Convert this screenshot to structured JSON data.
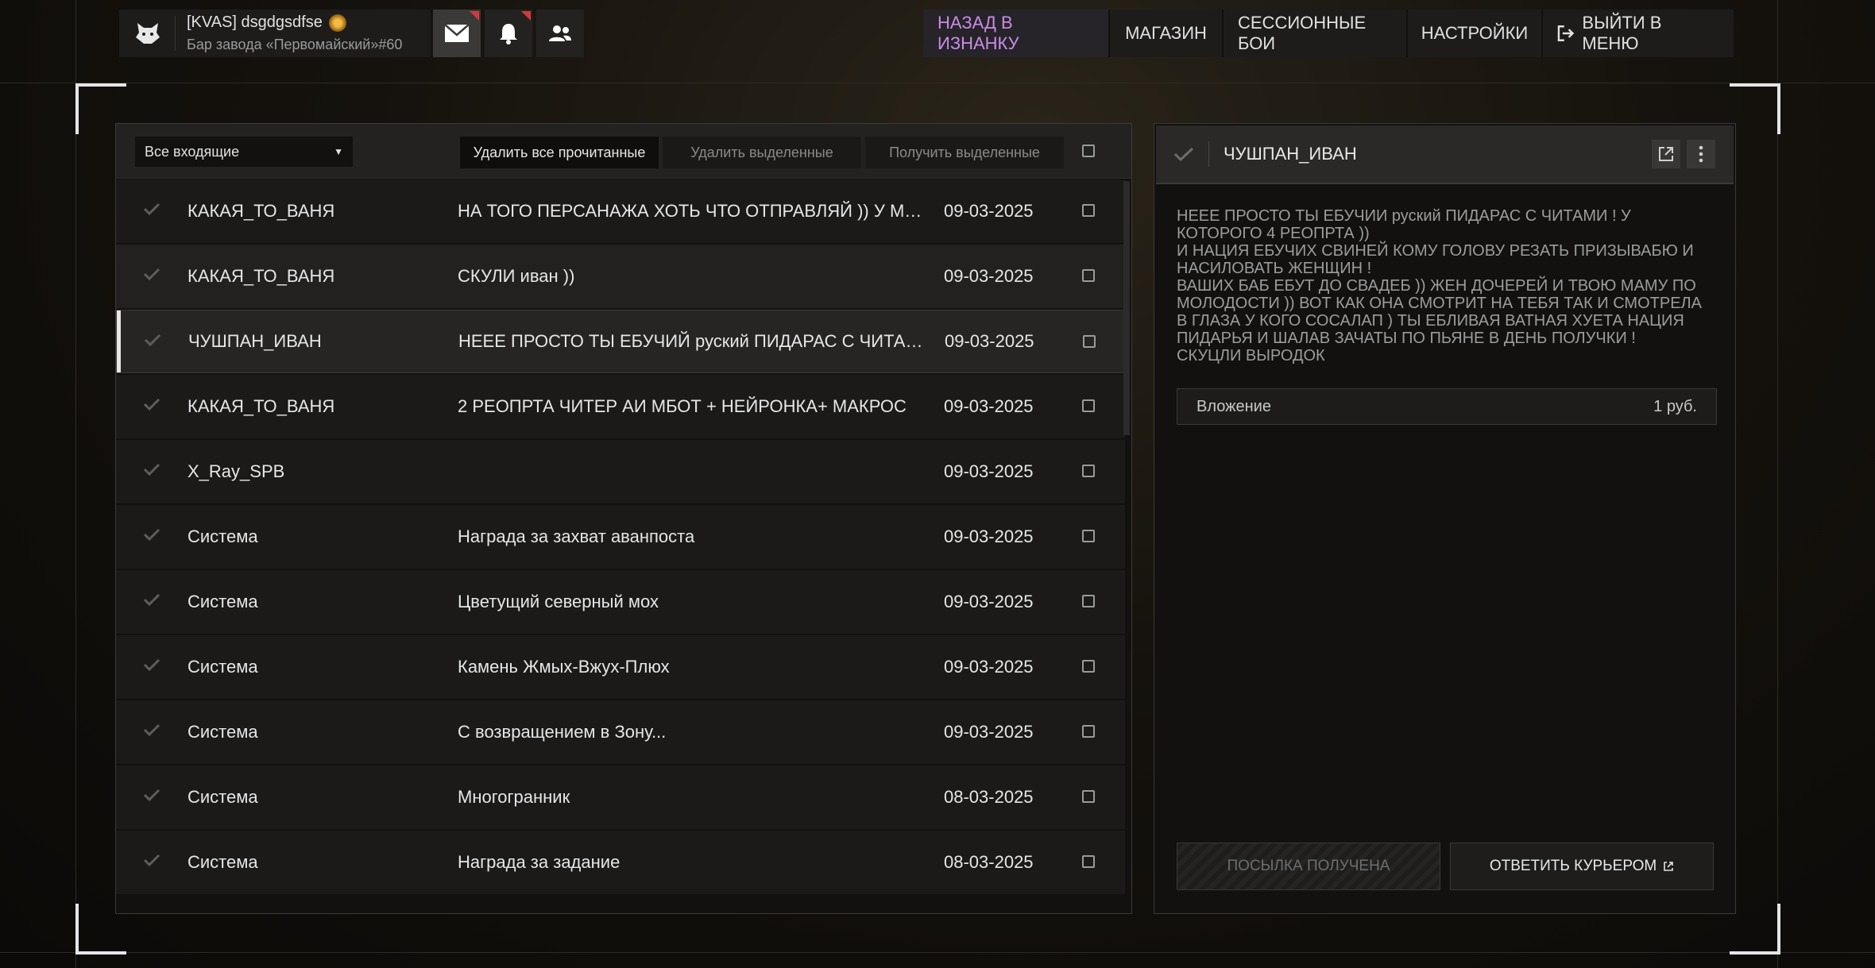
{
  "profile": {
    "name": "[KVAS] dsgdgsdfse",
    "location": "Бар завода «Первомайский»#60"
  },
  "nav": {
    "items": [
      "НАЗАД В ИЗНАНКУ",
      "МАГАЗИН",
      "СЕССИОННЫЕ БОИ",
      "НАСТРОЙКИ",
      "ВЫЙТИ В МЕНЮ"
    ]
  },
  "colors": {
    "accent": "#c98ce6",
    "notification": "#d23a3a"
  },
  "inbox": {
    "filter": "Все входящие",
    "delete_read": "Удалить все прочитанные",
    "delete_selected": "Удалить выделенные",
    "get_selected": "Получить выделенные",
    "rows": [
      {
        "from": "КАКАЯ_ТО_ВАНЯ",
        "subject": "НА ТОГО ПЕРСАНАЖА ХОТЬ ЧТО ОТПРАВЛЯЙ )) У МЕНЯ И..",
        "date": "09-03-2025"
      },
      {
        "from": "КАКАЯ_ТО_ВАНЯ",
        "subject": "СКУЛИ иван ))",
        "date": "09-03-2025"
      },
      {
        "from": "ЧУШПАН_ИВАН",
        "subject": "НЕЕЕ ПРОСТО ТЫ ЕБУЧИЙ руский ПИДАРАС С ЧИТАМИ ! У ..",
        "date": "09-03-2025"
      },
      {
        "from": "КАКАЯ_ТО_ВАНЯ",
        "subject": "2 РЕОПРТА ЧИТЕР АИ МБОТ + НЕЙРОНКА+ МАКРОС",
        "date": "09-03-2025"
      },
      {
        "from": "X_Ray_SPB",
        "subject": "",
        "date": "09-03-2025"
      },
      {
        "from": "Система",
        "subject": "Награда за захват аванпоста",
        "date": "09-03-2025"
      },
      {
        "from": "Система",
        "subject": "Цветущий северный мох",
        "date": "09-03-2025"
      },
      {
        "from": "Система",
        "subject": "Камень Жмых-Вжух-Плюх",
        "date": "09-03-2025"
      },
      {
        "from": "Система",
        "subject": "С возвращением в Зону...",
        "date": "09-03-2025"
      },
      {
        "from": "Система",
        "subject": "Многогранник",
        "date": "08-03-2025"
      },
      {
        "from": "Система",
        "subject": "Награда за задание",
        "date": "08-03-2025"
      }
    ]
  },
  "message": {
    "sender": "ЧУШПАН_ИВАН",
    "body": "НЕЕЕ ПРОСТО ТЫ ЕБУЧИИ руский ПИДАРАС С ЧИТАМИ ! У\nКОТОРОГО 4 РЕОПРТА ))\nИ НАЦИЯ ЕБУЧИХ СВИНЕЙ КОМУ ГОЛОВУ РЕЗАТЬ ПРИЗЫВАБЮ И\nНАСИЛОВАТЬ ЖЕНЩИН !\nВАШИХ БАБ ЕБУТ ДО СВАДЕБ )) ЖЕН ДОЧЕРЕЙ И ТВОЮ МАМУ ПО\nМОЛОДОСТИ )) ВОТ КАК ОНА СМОТРИТ НА ТЕБЯ ТАК И СМОТРЕЛА\nВ ГЛАЗА У КОГО СОСАЛАП ) ТЫ ЕБЛИВАЯ ВАТНАЯ ХУЕТА НАЦИЯ\nПИДАРЬЯ И ШАЛАВ ЗАЧАТЫ ПО ПЬЯНЕ В ДЕНЬ ПОЛУЧКИ !\nСКУЦЛИ ВЫРОДОК",
    "attachment_label": "Вложение",
    "attachment_value": "1 руб.",
    "received_label": "ПОСЫЛКА ПОЛУЧЕНА",
    "reply_label": "ОТВЕТИТЬ КУРЬЕРОМ"
  }
}
